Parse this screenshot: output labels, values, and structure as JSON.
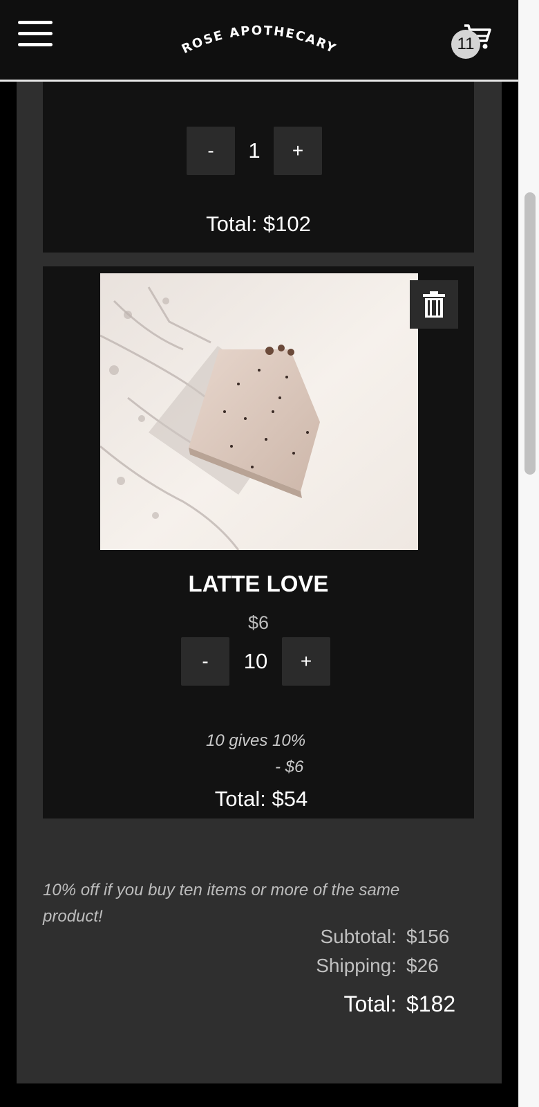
{
  "header": {
    "brand": "ROSE APOTHECARY",
    "cart_count": "11",
    "icons": {
      "menu": "hamburger-menu-icon",
      "cart": "shopping-cart-icon"
    }
  },
  "cart_items": [
    {
      "quantity": "1",
      "minus_label": "-",
      "plus_label": "+",
      "total": "Total: $102"
    },
    {
      "name": "LATTE LOVE",
      "price": "$6",
      "quantity": "10",
      "minus_label": "-",
      "plus_label": "+",
      "discount_line1": "10 gives 10%",
      "discount_line2": "- $6",
      "total": "Total: $54",
      "delete_icon": "trash-icon"
    }
  ],
  "promo_text": "10% off if you buy ten items or more of the same product!",
  "summary": {
    "subtotal_label": "Subtotal:",
    "subtotal_value": "$156",
    "shipping_label": "Shipping:",
    "shipping_value": "$26",
    "total_label": "Total:",
    "total_value": "$182"
  },
  "colors": {
    "page_bg": "#000000",
    "header_bg": "#0f0f0f",
    "container_bg": "#2f2f2f",
    "card_bg": "#121212",
    "button_bg": "#2b2b2b"
  }
}
